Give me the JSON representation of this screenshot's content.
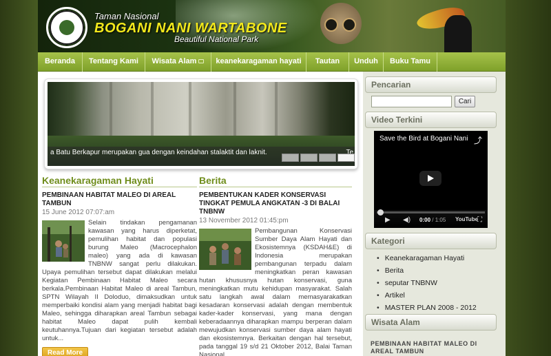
{
  "header": {
    "logo_text": "BALAI TAMAN NASIONAL BOGANI NANI WARTABONE",
    "pre_title": "Taman Nasional",
    "title": "BOGANI NANI WARTABONE",
    "tagline": "Beautiful National Park"
  },
  "nav": {
    "items": [
      {
        "label": "Beranda"
      },
      {
        "label": "Tentang Kami"
      },
      {
        "label": "Wisata Alam"
      },
      {
        "label": "keanekaragaman hayati"
      },
      {
        "label": "Tautan"
      },
      {
        "label": "Unduh"
      },
      {
        "label": "Buku Tamu"
      }
    ]
  },
  "slider": {
    "caption": "a Batu Berkapur merupakan gua dengan keindahan stalaktit dan laknit.",
    "caption_tail": "Te"
  },
  "biodiversity": {
    "section_title": "Keanekaragaman Hayati",
    "post_title": "PEMBINAAN HABITAT MALEO DI AREAL TAMBUN",
    "post_date": "15 June 2012 07:07:am",
    "post_body": "Selain tindakan pengamanan kawasan yang harus diperketat, pemulihan habitat dan populasi burung Maleo (Macrocephalon maleo) yang ada di kawasan TNBNW sangat perlu dilakukan. Upaya pemulihan tersebut dapat dilakukan melalui Kegiatan Pembinaan Habitat Maleo secara berkala.Pembinaan Habitat Maleo di areal Tambun, SPTN Wilayah II Doloduo, dimaksudkan untuk memperbaiki kondisi alam yang menjadi habitat bagi Maleo, sehingga diharapkan areal Tambun sebagai habitat Maleo dapat pulih kembali keutuhannya.Tujuan dari kegiatan tersebut adalah untuk...",
    "read_more": "Read More"
  },
  "news": {
    "section_title": "Berita",
    "post_title": "PEMBENTUKAN KADER KONSERVASI TINGKAT PEMULA ANGKATAN -3 DI BALAI TNBNW",
    "post_date": "13 November 2012 01:45:pm",
    "post_body": "Pembangunan Konservasi Sumber Daya Alam Hayati dan Ekosistemnya (KSDAH&E) di Indonesia merupakan pembangunan terpadu dalam meningkatkan peran kawasan hutan khususnya hutan konservasi, guna meningkatkan mutu kehidupan masyarakat. Salah satu langkah awal dalam memasyarakatkan kesadaran konservasi adalah dengan membentuk kader-kader konservasi, yang mana dengan keberadaannya diharapkan mampu berperan dalam mewujudkan konservasi sumber daya alam hayati dan ekosistemnya. Berkaitan dengan hal tersebut, pada tanggal 19 s/d 21 Oktober 2012, Balai Taman Nasional..."
  },
  "sidebar": {
    "search_title": "Pencarian",
    "search_placeholder": "",
    "search_button": "Cari",
    "video_title_label": "Video Terkini",
    "video": {
      "title": "Save the Bird at Bogani Nani",
      "time_current": "0:00",
      "time_total": "/ 1:05",
      "brand": "YouTube",
      "progress": 0
    },
    "categories_title": "Kategori",
    "categories": [
      "Keanekaragaman Hayati",
      "Berita",
      "seputar TNBNW",
      "Artikel",
      "MASTER PLAN 2008 - 2012"
    ],
    "wisata_title": "Wisata Alam",
    "wisata_post": "PEMBINAAN HABITAT MALEO DI AREAL TAMBUN"
  },
  "colors": {
    "nav_green": "#8fae35",
    "section_green": "#6f8d1b",
    "title_yellow": "#f3e91b",
    "button_orange": "#e3ad2a"
  }
}
